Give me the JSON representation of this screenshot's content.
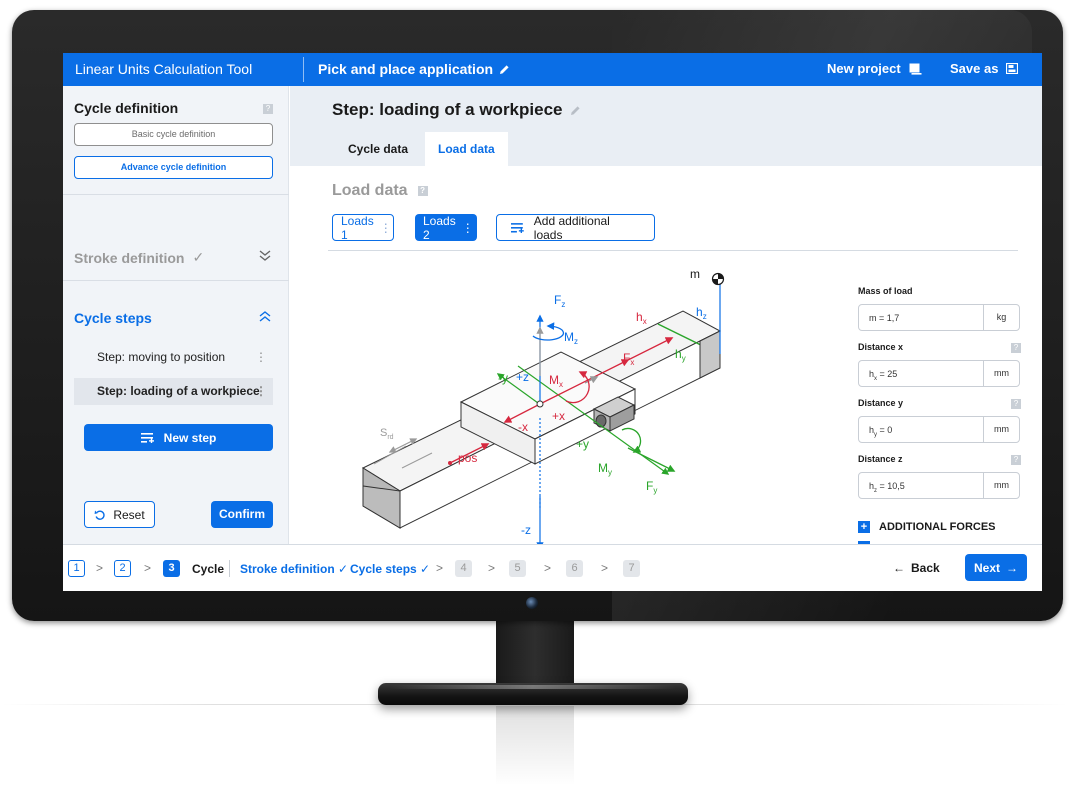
{
  "app": {
    "title": "Linear Units Calculation Tool",
    "project_title": "Pick and place application",
    "new_project_label": "New project",
    "save_as_label": "Save as",
    "accent_color": "#0a6ee6"
  },
  "sidebar": {
    "cycle_definition": {
      "heading": "Cycle definition",
      "help": "?",
      "basic_button": "Basic cycle definition",
      "advanced_button": "Advance cycle definition"
    },
    "stroke_definition": {
      "heading": "Stroke definition",
      "check": "✓"
    },
    "cycle_steps": {
      "heading": "Cycle steps",
      "items": [
        {
          "label": "Step: moving to position",
          "active": false
        },
        {
          "label": "Step: loading of a workpiece",
          "active": true
        }
      ],
      "new_step_button": "New step"
    },
    "reset_button": "Reset",
    "confirm_button": "Confirm"
  },
  "main": {
    "step_title": "Step: loading of a workpiece",
    "tabs": [
      {
        "label": "Cycle data",
        "active": false
      },
      {
        "label": "Load data",
        "active": true
      }
    ],
    "load_heading": "Load data",
    "help": "?",
    "loads": [
      {
        "label": "Loads 1",
        "selected": false
      },
      {
        "label": "Loads 2",
        "selected": true
      }
    ],
    "add_loads_button": "Add additional loads"
  },
  "diagram": {
    "labels": {
      "m": "m",
      "fz": "F",
      "fz_sub": "z",
      "mz": "M",
      "mz_sub": "z",
      "hx": "h",
      "hx_sub": "x",
      "hz": "h",
      "hz_sub": "z",
      "hy": "h",
      "hy_sub": "y",
      "fx": "F",
      "fx_sub": "x",
      "mx": "M",
      "mx_sub": "x",
      "plus_z": "+z",
      "minus_y": "-y",
      "plus_x": "+x",
      "minus_x": "-x",
      "plus_y": "+y",
      "minus_z": "-z",
      "my": "M",
      "my_sub": "y",
      "fy": "F",
      "fy_sub": "y",
      "srd": "S",
      "srd_sub": "rd",
      "pos": "pos"
    },
    "colors": {
      "red": "#d6283f",
      "green": "#2aa52a",
      "blue": "#0a6ee6",
      "gray": "#9a9a9a"
    }
  },
  "form": {
    "mass": {
      "label": "Mass of load",
      "value": "m = 1,7",
      "unit": "kg"
    },
    "distance_x": {
      "label": "Distance x",
      "value_main": "h",
      "value_sub": "x",
      "value_rest": " = 25",
      "unit": "mm"
    },
    "distance_y": {
      "label": "Distance y",
      "value_main": "h",
      "value_sub": "y",
      "value_rest": " = 0",
      "unit": "mm"
    },
    "distance_z": {
      "label": "Distance z",
      "value_main": "h",
      "value_sub": "z",
      "value_rest": " = 10,5",
      "unit": "mm"
    },
    "help": "?",
    "additional_forces": "ADDITIONAL FORCES",
    "plus": "+"
  },
  "footer": {
    "steps": [
      {
        "num": "1",
        "state": "done"
      },
      {
        "num": "2",
        "state": "done"
      },
      {
        "num": "3",
        "state": "current"
      },
      {
        "num": "4",
        "state": "todo"
      },
      {
        "num": "5",
        "state": "todo"
      },
      {
        "num": "6",
        "state": "todo"
      },
      {
        "num": "7",
        "state": "todo"
      }
    ],
    "current_label": "Cycle",
    "stroke_crumb": "Stroke definition",
    "cycle_steps_crumb": "Cycle steps",
    "back_label": "Back",
    "next_label": "Next"
  }
}
